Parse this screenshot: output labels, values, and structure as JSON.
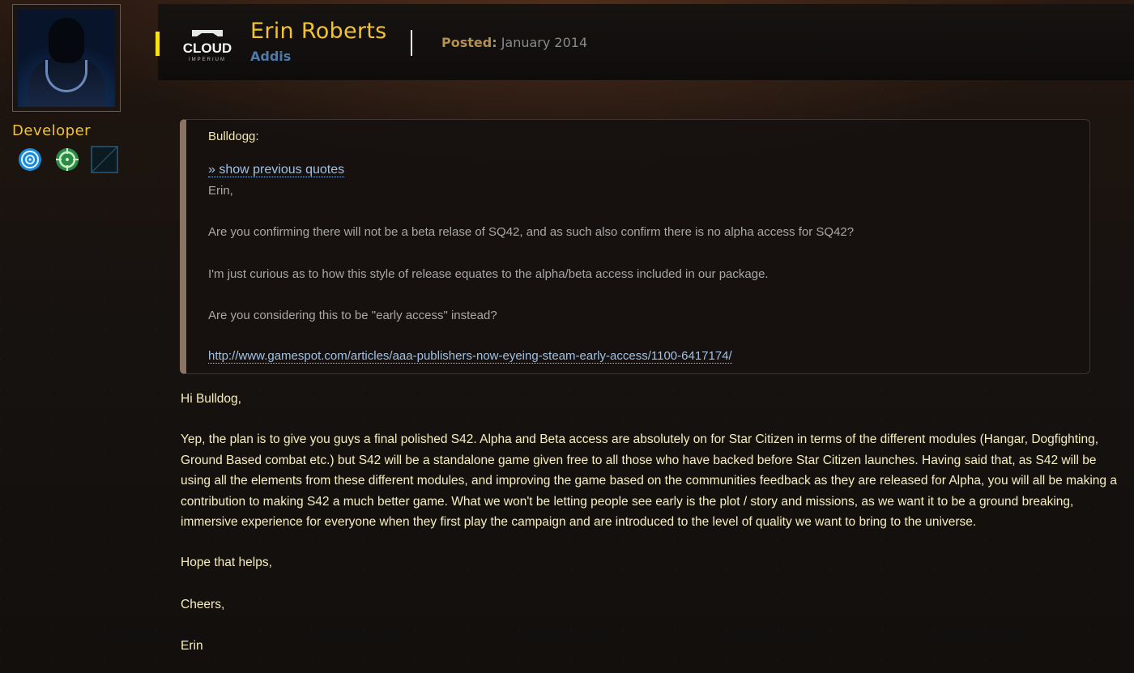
{
  "author": {
    "name": "Erin Roberts",
    "organization": "Addis",
    "role": "Developer",
    "logo_text": "CLOUD",
    "logo_subtext": "IMPERIUM",
    "badges": [
      "target-badge-icon",
      "crosshair-badge-icon",
      "empty-badge-slot"
    ]
  },
  "post": {
    "posted_label": "Posted:",
    "posted_date": "January 2014"
  },
  "quote": {
    "author": "Bulldogg:",
    "show_previous": "» show previous quotes",
    "lines": [
      "Erin,",
      "Are you confirming there will not be a beta relase of SQ42, and as such also confirm there is no alpha access for SQ42?",
      "I'm just curious as to how this style of release equates to the alpha/beta access included in our package.",
      "Are you considering this to be \"early access\" instead?"
    ],
    "link": "http://www.gamespot.com/articles/aaa-publishers-now-eyeing-steam-early-access/1100-6417174/"
  },
  "body": {
    "greeting": "Hi Bulldog,",
    "paragraph": "Yep, the plan is to give you guys a final polished S42. Alpha and Beta access are absolutely on for Star Citizen in terms of the different modules (Hangar, Dogfighting, Ground Based combat etc.) but S42 will be a standalone game given free to all those who have backed before Star Citizen launches. Having said that, as S42 will be using all the elements from these different modules, and improving the game based on the communities feedback as they are released for Alpha, you will all be making a contribution to making S42 a much better game. What we won't be letting people see early is the plot / story and missions, as we want it to be a ground breaking, immersive experience for everyone when they first play the campaign and are introduced to the level of quality we want to bring to the universe.",
    "closing1": "Hope that helps,",
    "closing2": "Cheers,",
    "signature": "Erin"
  },
  "colors": {
    "accent_yellow": "#f2c230",
    "link_blue": "#9fc2e4",
    "body_text": "#f6eebc",
    "org_blue": "#4f7aa8"
  }
}
